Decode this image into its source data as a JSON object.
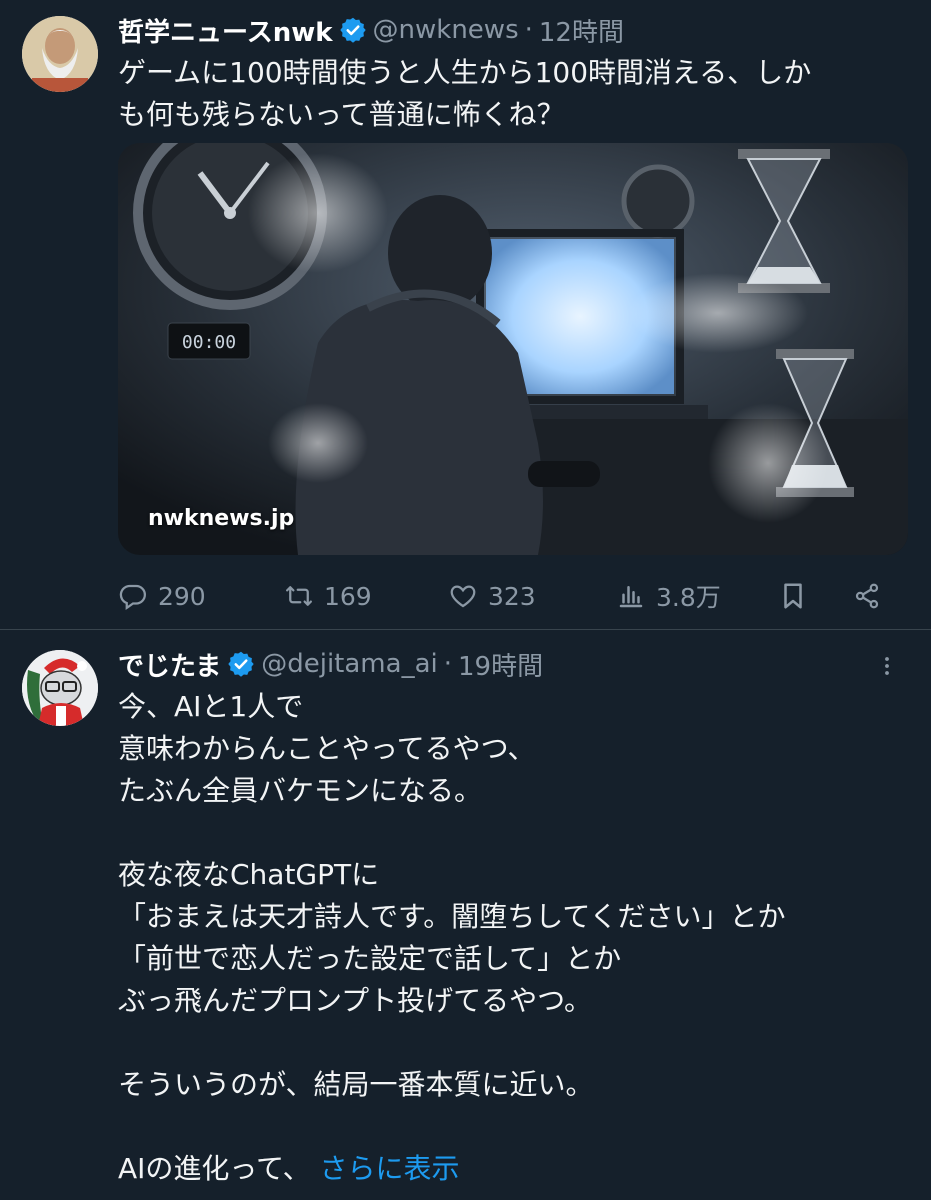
{
  "tweets": [
    {
      "name": "哲学ニュースnwk",
      "handle": "@nwknews",
      "dot": "·",
      "time": "12時間",
      "lines": [
        "ゲームに100時間使うと人生から100時間消える、しか",
        "も何も残らないって普通に怖くね？"
      ],
      "media": {
        "clock_text": "00:00",
        "source_label": "nwknews.jp"
      },
      "actions": {
        "reply_count": "290",
        "retweet_count": "169",
        "like_count": "323",
        "views_count": "3.8万"
      }
    },
    {
      "name": "でじたま",
      "handle": "@dejitama_ai",
      "dot": "·",
      "time": "19時間",
      "lines": [
        "今、AIと1人で",
        "意味わからんことやってるやつ、",
        "たぶん全員バケモンになる。",
        "",
        "夜な夜なChatGPTに",
        "「おまえは天才詩人です。闇堕ちしてください」とか",
        "「前世で恋人だった設定で話して」とか",
        "ぶっ飛んだプロンプト投げてるやつ。",
        "",
        "そういうのが、結局一番本質に近い。",
        ""
      ],
      "last_line_text": "AIの進化って、",
      "show_more": "さらに表示"
    }
  ],
  "colors": {
    "background": "#15202b",
    "secondary_text": "#8b98a5",
    "link": "#1d9bf0",
    "verified": "#1d9bf0",
    "divider": "#38444d"
  }
}
